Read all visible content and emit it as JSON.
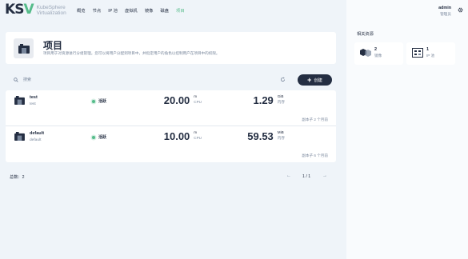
{
  "brand": {
    "mark_k": "K",
    "mark_s": "S",
    "mark_v": "V",
    "line1": "KubeSphere",
    "line2": "Virtualization"
  },
  "nav": {
    "items": [
      {
        "label": "概览",
        "active": false
      },
      {
        "label": "节点",
        "active": false
      },
      {
        "label": "IP 池",
        "active": false
      },
      {
        "label": "虚拟机",
        "active": false
      },
      {
        "label": "镜像",
        "active": false
      },
      {
        "label": "磁盘",
        "active": false
      },
      {
        "label": "项目",
        "active": true
      }
    ]
  },
  "header": {
    "title": "项目",
    "description": "项目用于对资源进行分组管理。您可以将用户分配到项目中，并指定用户的角色以控制用户在项目中的权限。"
  },
  "toolbar": {
    "search_placeholder": "搜索",
    "create_label": "创建"
  },
  "projects": [
    {
      "name": "test",
      "subname": "test",
      "status": "活跃",
      "cpu_value": "20.00",
      "cpu_unit": "m",
      "cpu_label": "CPU",
      "mem_value": "1.29",
      "mem_unit": "GiB",
      "mem_label": "内存",
      "footer": "副本子 2 个月前"
    },
    {
      "name": "default",
      "subname": "default",
      "status": "活跃",
      "cpu_value": "10.00",
      "cpu_unit": "m",
      "cpu_label": "CPU",
      "mem_value": "59.53",
      "mem_unit": "MiB",
      "mem_label": "内存",
      "footer": "副本子 6 个月前"
    }
  ],
  "pagination": {
    "total": "总数：2",
    "page": "1 / 1"
  },
  "user": {
    "name": "admin",
    "role": "管理员"
  },
  "side": {
    "title": "相关资源",
    "resources": [
      {
        "count": "2",
        "label": "镜像",
        "icon": "images-icon"
      },
      {
        "count": "1",
        "label": "IP 池",
        "icon": "ip-pool-icon"
      }
    ]
  },
  "colors": {
    "accent": "#55bc8a",
    "dark": "#242e42",
    "muted": "#79879c",
    "background": "#eff4f9"
  }
}
